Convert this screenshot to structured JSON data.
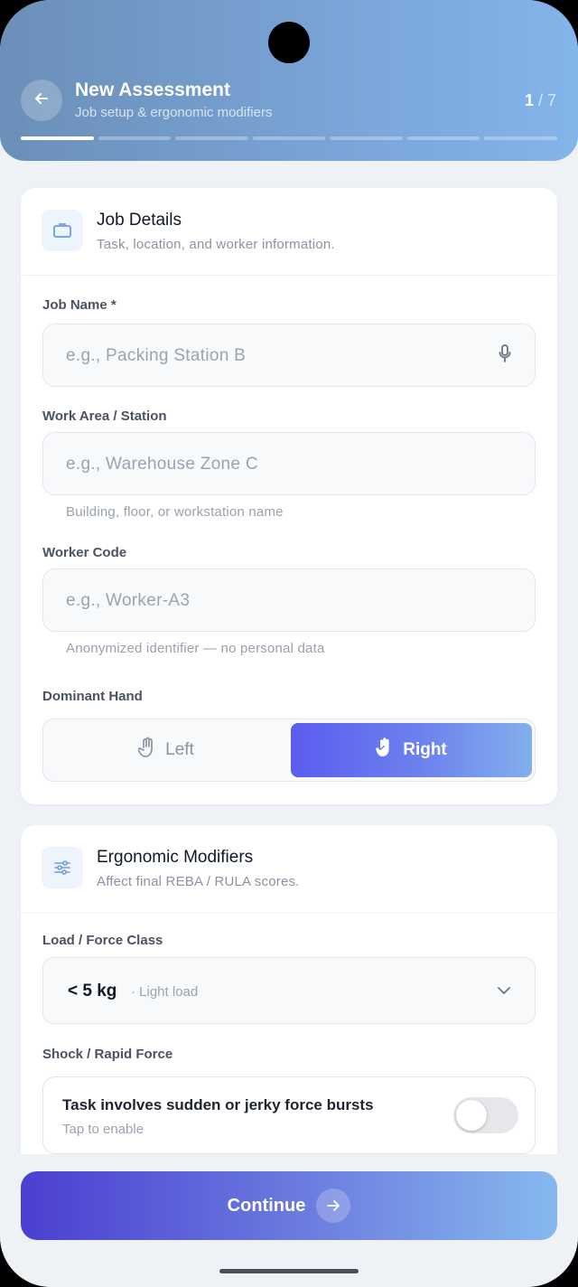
{
  "header": {
    "title": "New Assessment",
    "subtitle": "Job setup & ergonomic modifiers",
    "step_current": "1",
    "step_total": " / 7",
    "total_steps": 7,
    "completed_steps": 1
  },
  "job_details": {
    "title": "Job Details",
    "subtitle": "Task, location, and worker information.",
    "job_name_label": "Job Name *",
    "job_name_placeholder": "e.g., Packing Station B",
    "work_area_label": "Work Area / Station",
    "work_area_placeholder": "e.g., Warehouse Zone C",
    "work_area_hint": "Building, floor, or workstation name",
    "worker_code_label": "Worker Code",
    "worker_code_placeholder": "e.g., Worker-A3",
    "worker_code_hint": "Anonymized identifier — no personal data",
    "dominant_hand_label": "Dominant Hand",
    "hand_left": "Left",
    "hand_right": "Right",
    "selected_hand": "Right"
  },
  "ergonomic": {
    "title": "Ergonomic Modifiers",
    "subtitle": "Affect final REBA / RULA scores.",
    "load_label": "Load / Force Class",
    "load_value": "< 5 kg",
    "load_note": "· Light load",
    "shock_label": "Shock / Rapid Force",
    "shock_text": "Task involves sudden or jerky force bursts",
    "shock_hint": "Tap to enable",
    "shock_enabled": false
  },
  "footer": {
    "continue_label": "Continue"
  },
  "colors": {
    "accent": "#5b5cf0",
    "header_gradient_start": "#6b8fb8",
    "header_gradient_end": "#83b4ea"
  }
}
